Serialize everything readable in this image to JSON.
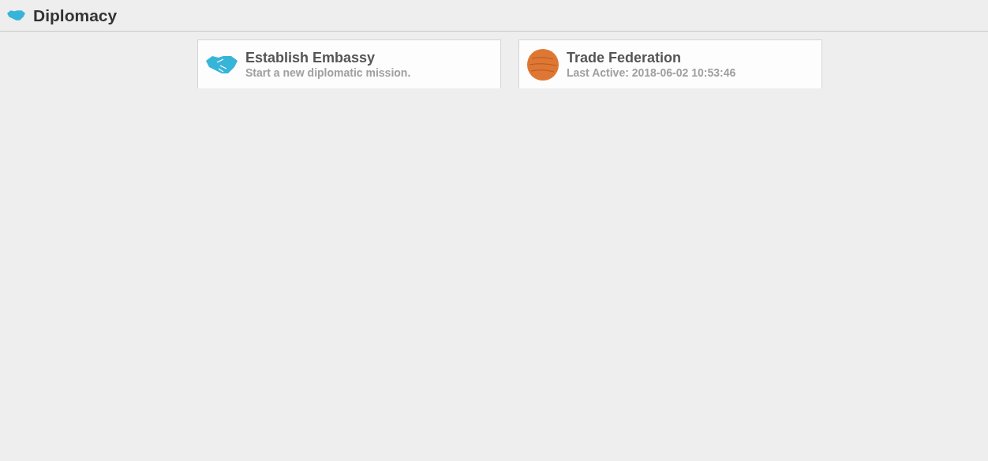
{
  "header": {
    "title": "Diplomacy"
  },
  "cards": [
    {
      "kind": "new",
      "title": "Establish Embassy",
      "subtitle": "Start a new diplomatic mission."
    },
    {
      "kind": "empire",
      "title": "Trade Federation",
      "subtitle": "Last Active: 2018-06-02 10:53:46"
    }
  ]
}
